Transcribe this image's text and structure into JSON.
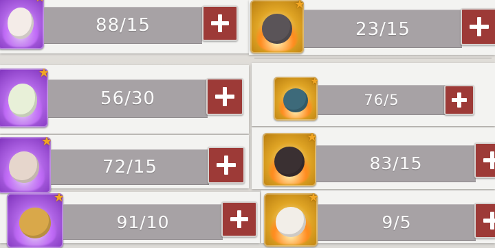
{
  "colors": {
    "bar": "#a7a2a5",
    "plus_button": "#9d3a37",
    "panel": "#f3f3f1",
    "rarity_purple": "#9b4bd6",
    "rarity_gold": "#e0a525"
  },
  "icons": {
    "plus": "plus-icon",
    "star": "star-badge-icon"
  },
  "cards": [
    {
      "value": "88/15",
      "rarity": "purple",
      "creature": "white-fox-spirit"
    },
    {
      "value": "23/15",
      "rarity": "gold",
      "creature": "dark-wolf-spirit"
    },
    {
      "value": "56/30",
      "rarity": "purple",
      "creature": "leaf-sprout-spirit"
    },
    {
      "value": "76/5",
      "rarity": "gold",
      "creature": "teal-ghost-spirit"
    },
    {
      "value": "72/15",
      "rarity": "purple",
      "creature": "monkey-spirit"
    },
    {
      "value": "83/15",
      "rarity": "gold",
      "creature": "black-fire-bear"
    },
    {
      "value": "91/10",
      "rarity": "purple",
      "creature": "golden-lion-spirit"
    },
    {
      "value": "9/5",
      "rarity": "gold",
      "creature": "white-cat-spirit"
    }
  ]
}
